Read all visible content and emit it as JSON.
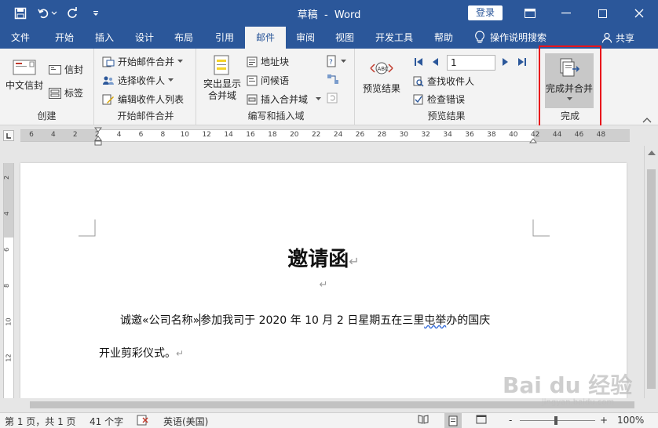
{
  "titlebar": {
    "doc_name": "草稿",
    "separator": "-",
    "app_name": "Word",
    "login_label": "登录"
  },
  "tabs": [
    "文件",
    "开始",
    "插入",
    "设计",
    "布局",
    "引用",
    "邮件",
    "审阅",
    "视图",
    "开发工具",
    "帮助"
  ],
  "active_tab": "邮件",
  "tell_me": "操作说明搜索",
  "share_label": "共享",
  "ribbon": {
    "create": {
      "label": "创建",
      "chinese_envelope": "中文信封",
      "envelope": "信封",
      "labels": "标签"
    },
    "start_merge": {
      "label": "开始邮件合并",
      "start": "开始邮件合并",
      "select_recipients": "选择收件人",
      "edit_list": "编辑收件人列表"
    },
    "write_insert": {
      "label": "编写和插入域",
      "highlight": "突出显示合并域",
      "address_block": "地址块",
      "greeting": "问候语",
      "insert_field": "插入合并域"
    },
    "preview": {
      "label": "预览结果",
      "preview_results": "预览结果",
      "record": "1",
      "find_recipient": "查找收件人",
      "check_errors": "检查错误"
    },
    "finish": {
      "label": "完成",
      "finish_merge": "完成并合并"
    }
  },
  "ruler": {
    "labels": [
      "6",
      "4",
      "2",
      "2",
      "4",
      "6",
      "8",
      "10",
      "12",
      "14",
      "16",
      "18",
      "20",
      "22",
      "24",
      "26",
      "28",
      "30",
      "32",
      "34",
      "36",
      "38",
      "40",
      "42",
      "44",
      "46",
      "48"
    ],
    "vlabels": [
      "2",
      "4",
      "6",
      "8",
      "10",
      "12"
    ]
  },
  "document": {
    "title": "邀请函",
    "para_mark": "↵",
    "line1_before": "诚邀",
    "merge_field": "«公司名称»",
    "line1_mid": "参加我司于 2020 年 10 月 2 日星期五在三里",
    "line1_squiggle": "屯举",
    "line1_after": "办的国庆",
    "line2": "开业剪彩仪式。"
  },
  "status": {
    "pages": "第 1 页，共 1 页",
    "words": "41 个字",
    "language": "英语(美国)",
    "zoom_minus": "-",
    "zoom_plus": "+",
    "zoom_level": "100%"
  },
  "watermark": {
    "brand": "Bai du 经验",
    "url": "jingyan.baidu.com"
  },
  "colors": {
    "brand": "#2b579a",
    "highlight_box": "#e8141b"
  }
}
